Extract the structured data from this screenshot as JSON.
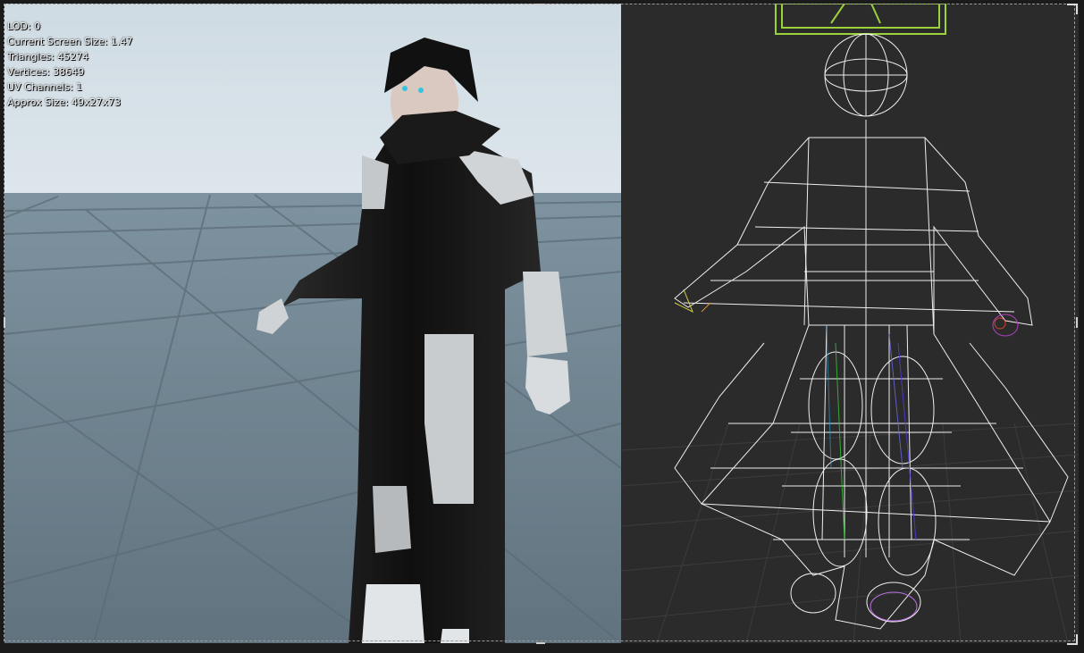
{
  "viewport_left": {
    "stats": [
      "LOD: 0",
      "Current Screen Size: 1.47",
      "Triangles: 45274",
      "Vertices: 38649",
      "UV Channels: 1",
      "Approx Size: 49x27x73"
    ]
  },
  "viewport_right": {
    "mode": "wireframe",
    "wire_color": "#ffffff",
    "bbox_color": "#9bd23a"
  },
  "colors": {
    "sky": "#b9ccd8",
    "floor": "#6f8593",
    "dark_floor": "#2b2b2b"
  }
}
